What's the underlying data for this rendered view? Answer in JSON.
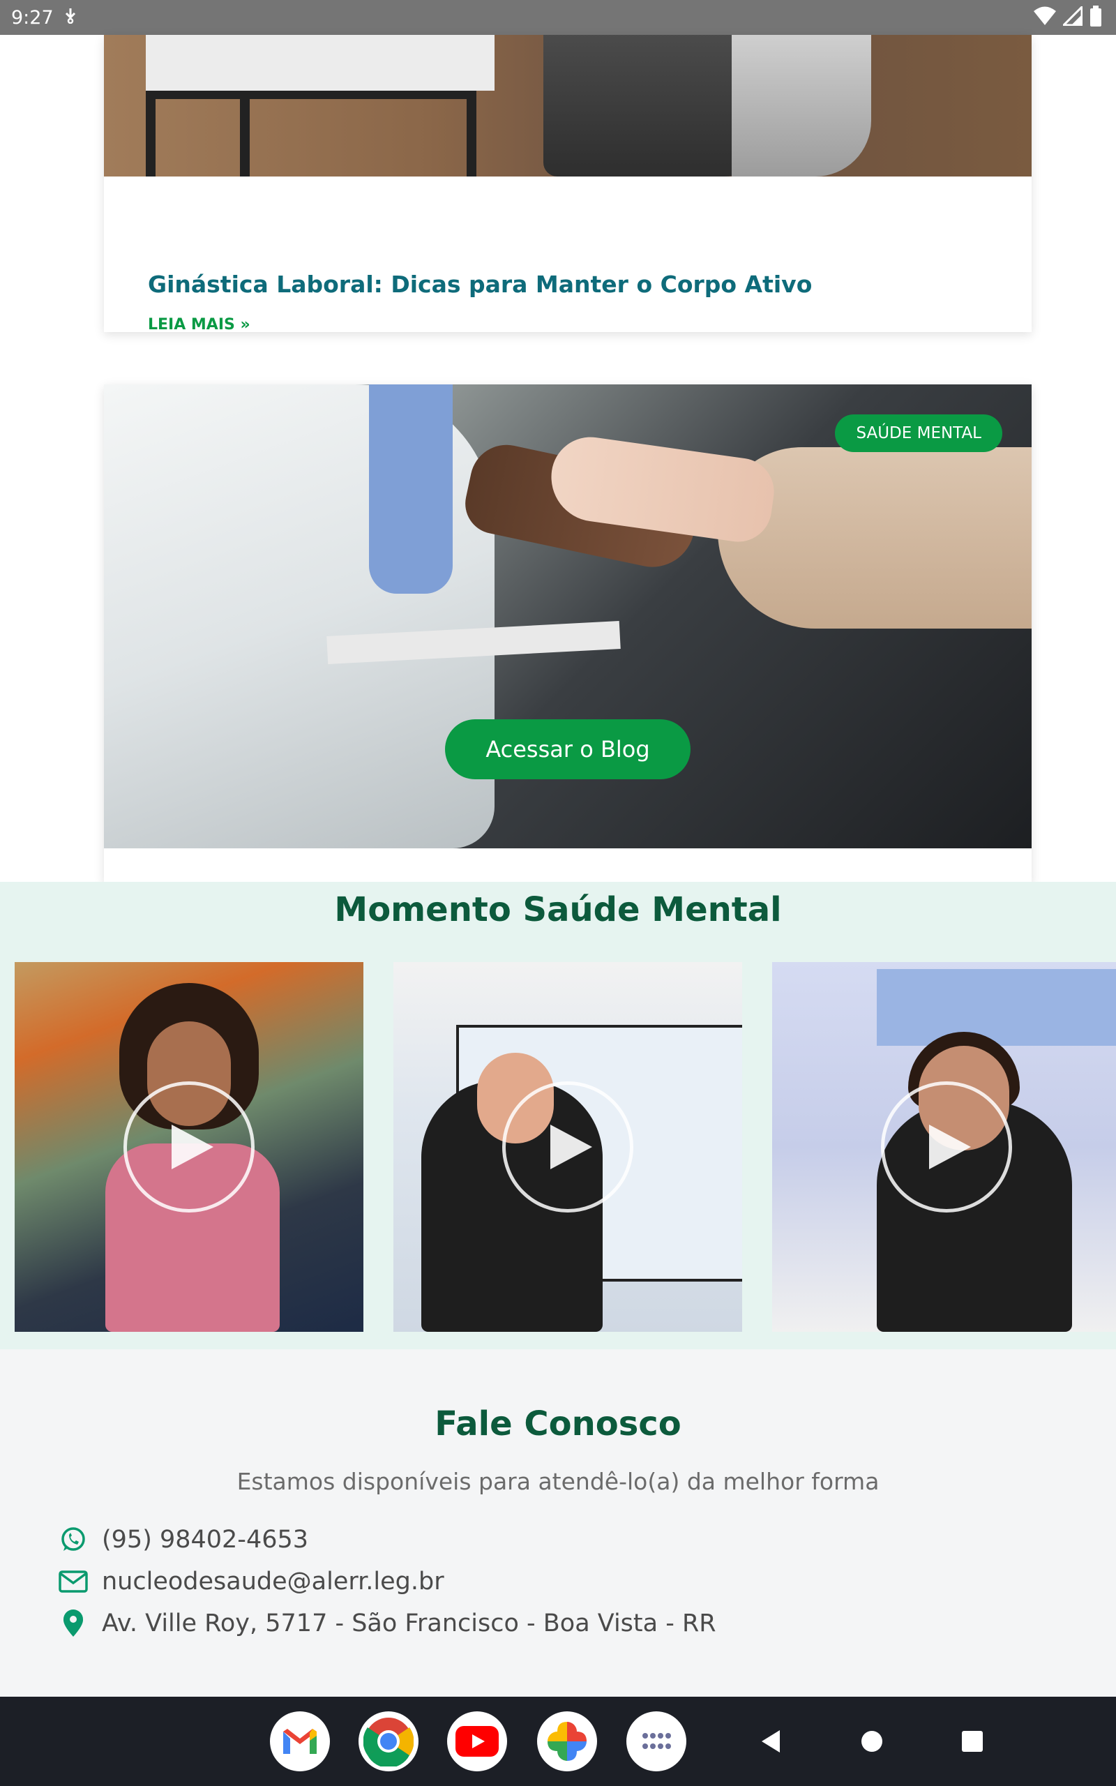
{
  "status_bar": {
    "time": "9:27",
    "icons": [
      "download-icon",
      "wifi-icon",
      "signal-icon",
      "battery-icon"
    ]
  },
  "post_card": {
    "title": "Ginástica Laboral: Dicas para Manter o Corpo Ativo",
    "read_more": "LEIA MAIS »"
  },
  "blog_card": {
    "category_tag": "SAÚDE MENTAL",
    "button_label": "Acessar o Blog"
  },
  "momento": {
    "title": "Momento Saúde Mental",
    "videos": [
      {
        "icon": "play-icon"
      },
      {
        "icon": "play-icon"
      },
      {
        "icon": "play-icon"
      }
    ]
  },
  "contact": {
    "title": "Fale Conosco",
    "subtitle": "Estamos disponíveis para atendê-lo(a) da melhor forma",
    "phone": "(95) 98402-4653",
    "email": "nucleodesaude@alerr.leg.br",
    "address": "Av. Ville Roy, 5717 - São Francisco - Boa Vista - RR"
  },
  "nav_bar": {
    "apps": [
      "gmail-icon",
      "chrome-icon",
      "youtube-icon",
      "photos-icon",
      "app-drawer-icon"
    ],
    "buttons": [
      "back-icon",
      "home-icon",
      "recents-icon"
    ]
  },
  "colors": {
    "brand_green": "#0a9a44",
    "heading_green": "#0c5a3c",
    "title_teal": "#0e6b7a",
    "momento_bg": "#e6f4f0"
  }
}
